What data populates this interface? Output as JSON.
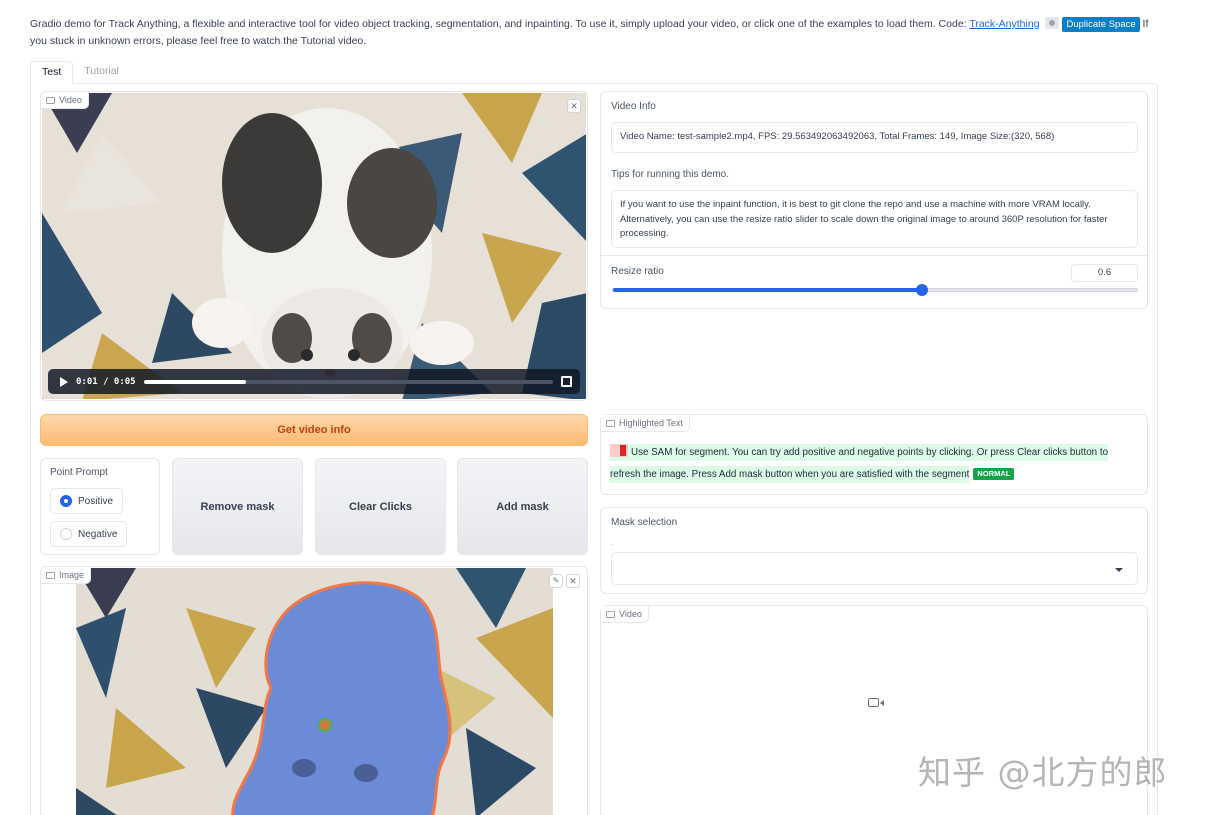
{
  "intro": {
    "text": "Gradio demo for Track Anything, a flexible and interactive tool for video object tracking, segmentation, and inpainting. To use it, simply upload your video, or click one of the examples to load them. Code: ",
    "link": "Track-Anything",
    "duplicate_badge": "Duplicate Space",
    "text_after": " If you stuck in unknown errors, please feel free to watch the Tutorial video."
  },
  "tabs": [
    "Test",
    "Tutorial"
  ],
  "video_player": {
    "label": "Video",
    "time": "0:01 / 0:05",
    "progress_fraction": 0.25
  },
  "get_info_button": "Get video info",
  "point_prompt": {
    "title": "Point Prompt",
    "options": [
      "Positive",
      "Negative"
    ],
    "selected": "Positive"
  },
  "buttons": {
    "remove_mask": "Remove mask",
    "clear_clicks": "Clear Clicks",
    "add_mask": "Add mask"
  },
  "image_panel": {
    "label": "Image"
  },
  "video_info": {
    "label": "Video Info",
    "value": "Video Name: test-sample2.mp4, FPS: 29.563492063492063, Total Frames: 149, Image Size:(320, 568)"
  },
  "tips": {
    "label": "Tips for running this demo.",
    "value": "If you want to use the inpaint function, it is best to git clone the repo and use a machine with more VRAM locally. Alternatively, you can use the resize ratio slider to scale down the original image to around 360P resolution for faster processing."
  },
  "resize_ratio": {
    "label": "Resize ratio",
    "value": "0.6",
    "fraction": 0.59
  },
  "highlighted_text": {
    "label": "Highlighted Text",
    "text": "Use SAM for segment. You can try add positive and negative points by clicking. Or press Clear clicks button to refresh the image. Press Add mask button when you are satisfied with the segment",
    "tag": "NORMAL"
  },
  "mask_selection": {
    "label": "Mask selection",
    "hint": "."
  },
  "output_video": {
    "label": "Video"
  },
  "watermark": "知乎 @北方的郎",
  "colors": {
    "accent": "#2563eb",
    "primary_button": "#fdba74",
    "highlight": "#dcfce7",
    "tag": "#16a34a",
    "mask_overlay": "#6b8bd6",
    "mask_outline": "#f07848"
  }
}
